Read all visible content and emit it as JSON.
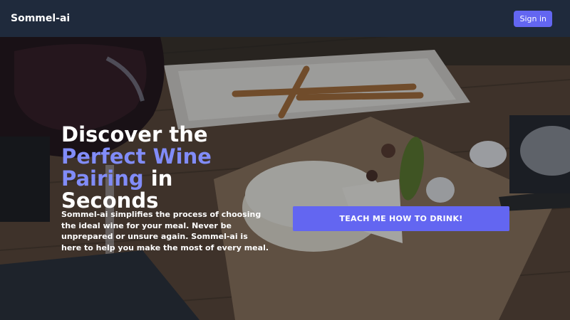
{
  "navbar": {
    "brand": "Sommel-ai",
    "signin_label": "Sign in"
  },
  "hero": {
    "headline_part1": "Discover the",
    "headline_accent": "Perfect Wine Pairing",
    "headline_part2": "in Seconds",
    "description": "Sommel-ai simplifies the process of choosing the ideal wine for your meal. Never be unprepared or unsure again. Sommel-ai is here to help you make the most of every meal.",
    "cta_label": "TEACH ME HOW TO DRINK!",
    "background_image": "wine-and-cheese-board-photo"
  },
  "colors": {
    "navbar_bg": "#1f2a3c",
    "accent": "#6366f1",
    "accent_text": "#818cf8"
  }
}
